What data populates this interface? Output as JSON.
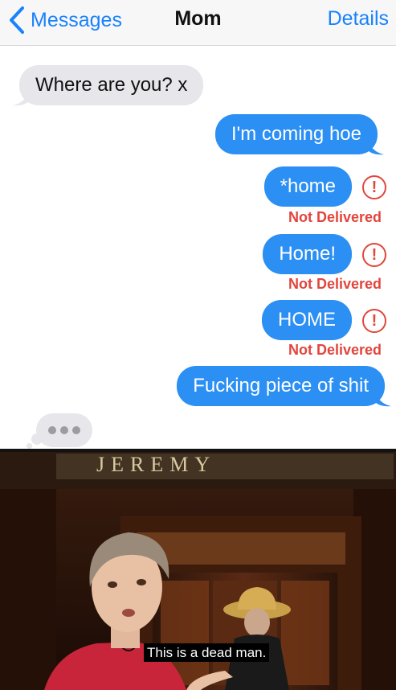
{
  "navbar": {
    "back_label": "Messages",
    "title": "Mom",
    "details_label": "Details"
  },
  "messages": [
    {
      "direction": "incoming",
      "text": "Where are you? x"
    },
    {
      "direction": "outgoing",
      "text": "I'm coming hoe"
    },
    {
      "direction": "outgoing",
      "text": "*home",
      "status": "Not Delivered",
      "error_icon": "!"
    },
    {
      "direction": "outgoing",
      "text": "Home!",
      "status": "Not Delivered",
      "error_icon": "!"
    },
    {
      "direction": "outgoing",
      "text": "HOME",
      "status": "Not Delivered",
      "error_icon": "!"
    },
    {
      "direction": "outgoing",
      "text": "Fucking piece of shit"
    }
  ],
  "typing_indicator": {
    "icon": "typing-dots-icon"
  },
  "meme": {
    "caption": "This is a dead man.",
    "sign_text": "JEREMY"
  },
  "colors": {
    "accent_blue": "#1a82fb",
    "outgoing_bubble": "#2b8ff3",
    "incoming_bubble": "#e6e6eb",
    "error_red": "#e2453c"
  }
}
